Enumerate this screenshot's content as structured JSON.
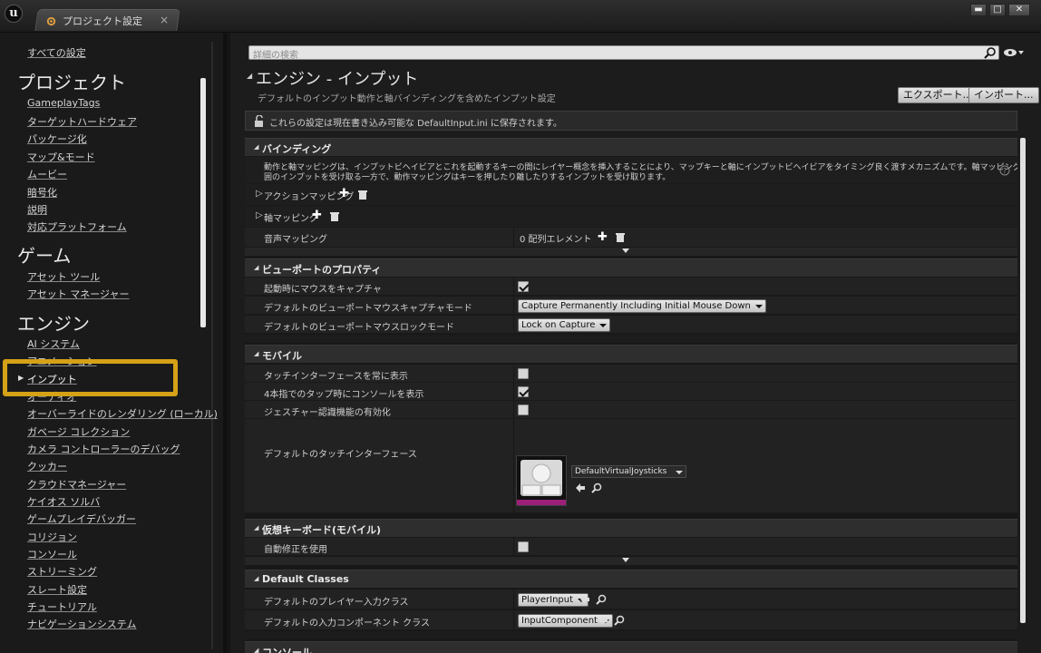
{
  "window": {
    "logo_text": "u",
    "tab_label": "プロジェクト設定",
    "close_glyph": "×",
    "minimize": "▬",
    "maximize": "□",
    "close": "✕"
  },
  "sidebar": {
    "all_settings": "すべての設定",
    "project_heading": "プロジェクト",
    "project_items": [
      "GameplayTags",
      "ターゲットハードウェア",
      "パッケージ化",
      "マップ&モード",
      "ムービー",
      "暗号化",
      "説明",
      "対応プラットフォーム"
    ],
    "game_heading": "ゲーム",
    "game_items": [
      "アセット ツール",
      "アセット マネージャー"
    ],
    "engine_heading": "エンジン",
    "engine_items": [
      "AI システム",
      "アニメーション",
      "インプット",
      "オーディオ",
      "オーバーライドのレンダリング (ローカル)",
      "ガベージ コレクション",
      "カメラ コントローラーのデバッグ",
      "クッカー",
      "クラウドマネージャー",
      "ケイオス ソルバ",
      "ゲームプレイデバッガー",
      "コリジョン",
      "コンソール",
      "ストリーミング",
      "スレート設定",
      "チュートリアル",
      "ナビゲーションシステム"
    ],
    "selected_index": 2,
    "accent_color": "#d4a117"
  },
  "main": {
    "search_placeholder": "詳細の検索",
    "title": "エンジン - インプット",
    "description": "デフォルトのインプット動作と軸バインディングを含めたインプット設定",
    "export_label": "エクスポート...",
    "import_label": "インポート...",
    "notice": "これらの設定は現在書き込み可能な DefaultInput.ini に保存されます。"
  },
  "bindings": {
    "header": "バインディング",
    "description_line1": "動作と軸マッピングは、インプットビヘイビアとこれを起動するキーの間にレイヤー概念を挿入することにより、マップキーと軸にインプットビヘイビアをタイミング良く渡すメカニズムです。軸マッピングは連続的な範",
    "description_line2": "囲のインプットを受け取る一方で、動作マッピングはキーを押したり離したりするインプットを受け取ります。",
    "action_mappings": "アクションマッピング",
    "axis_mappings": "軸マッピング",
    "speech_mappings": "音声マッピング",
    "speech_value": "0 配列エレメント"
  },
  "viewport": {
    "header": "ビューポートのプロパティ",
    "capture_on_start": "起動時にマウスをキャプチャ",
    "capture_mode_label": "デフォルトのビューポートマウスキャプチャモード",
    "capture_mode_value": "Capture Permanently Including Initial Mouse Down",
    "lock_mode_label": "デフォルトのビューポートマウスロックモード",
    "lock_mode_value": "Lock on Capture"
  },
  "mobile": {
    "header": "モバイル",
    "always_show_touch": "タッチインターフェースを常に表示",
    "four_finger_console": "4本指でのタップ時にコンソールを表示",
    "gesture_recognizer": "ジェスチャー認識機能の有効化",
    "default_touch_interface": "デフォルトのタッチインターフェース",
    "touch_interface_value": "DefaultVirtualJoysticks"
  },
  "virtual_keyboard": {
    "header": "仮想キーボード(モバイル)",
    "autocorrect": "自動修正を使用"
  },
  "default_classes": {
    "header": "Default Classes",
    "player_input_label": "デフォルトのプレイヤー入力クラス",
    "player_input_value": "PlayerInput",
    "input_component_label": "デフォルトの入力コンポーネント クラス",
    "input_component_value": "InputComponent"
  },
  "console": {
    "header": "コンソール"
  },
  "checkbox_states": {
    "capture_on_start": true,
    "always_show_touch": false,
    "four_finger_console": true,
    "gesture_recognizer": false,
    "autocorrect": false
  }
}
